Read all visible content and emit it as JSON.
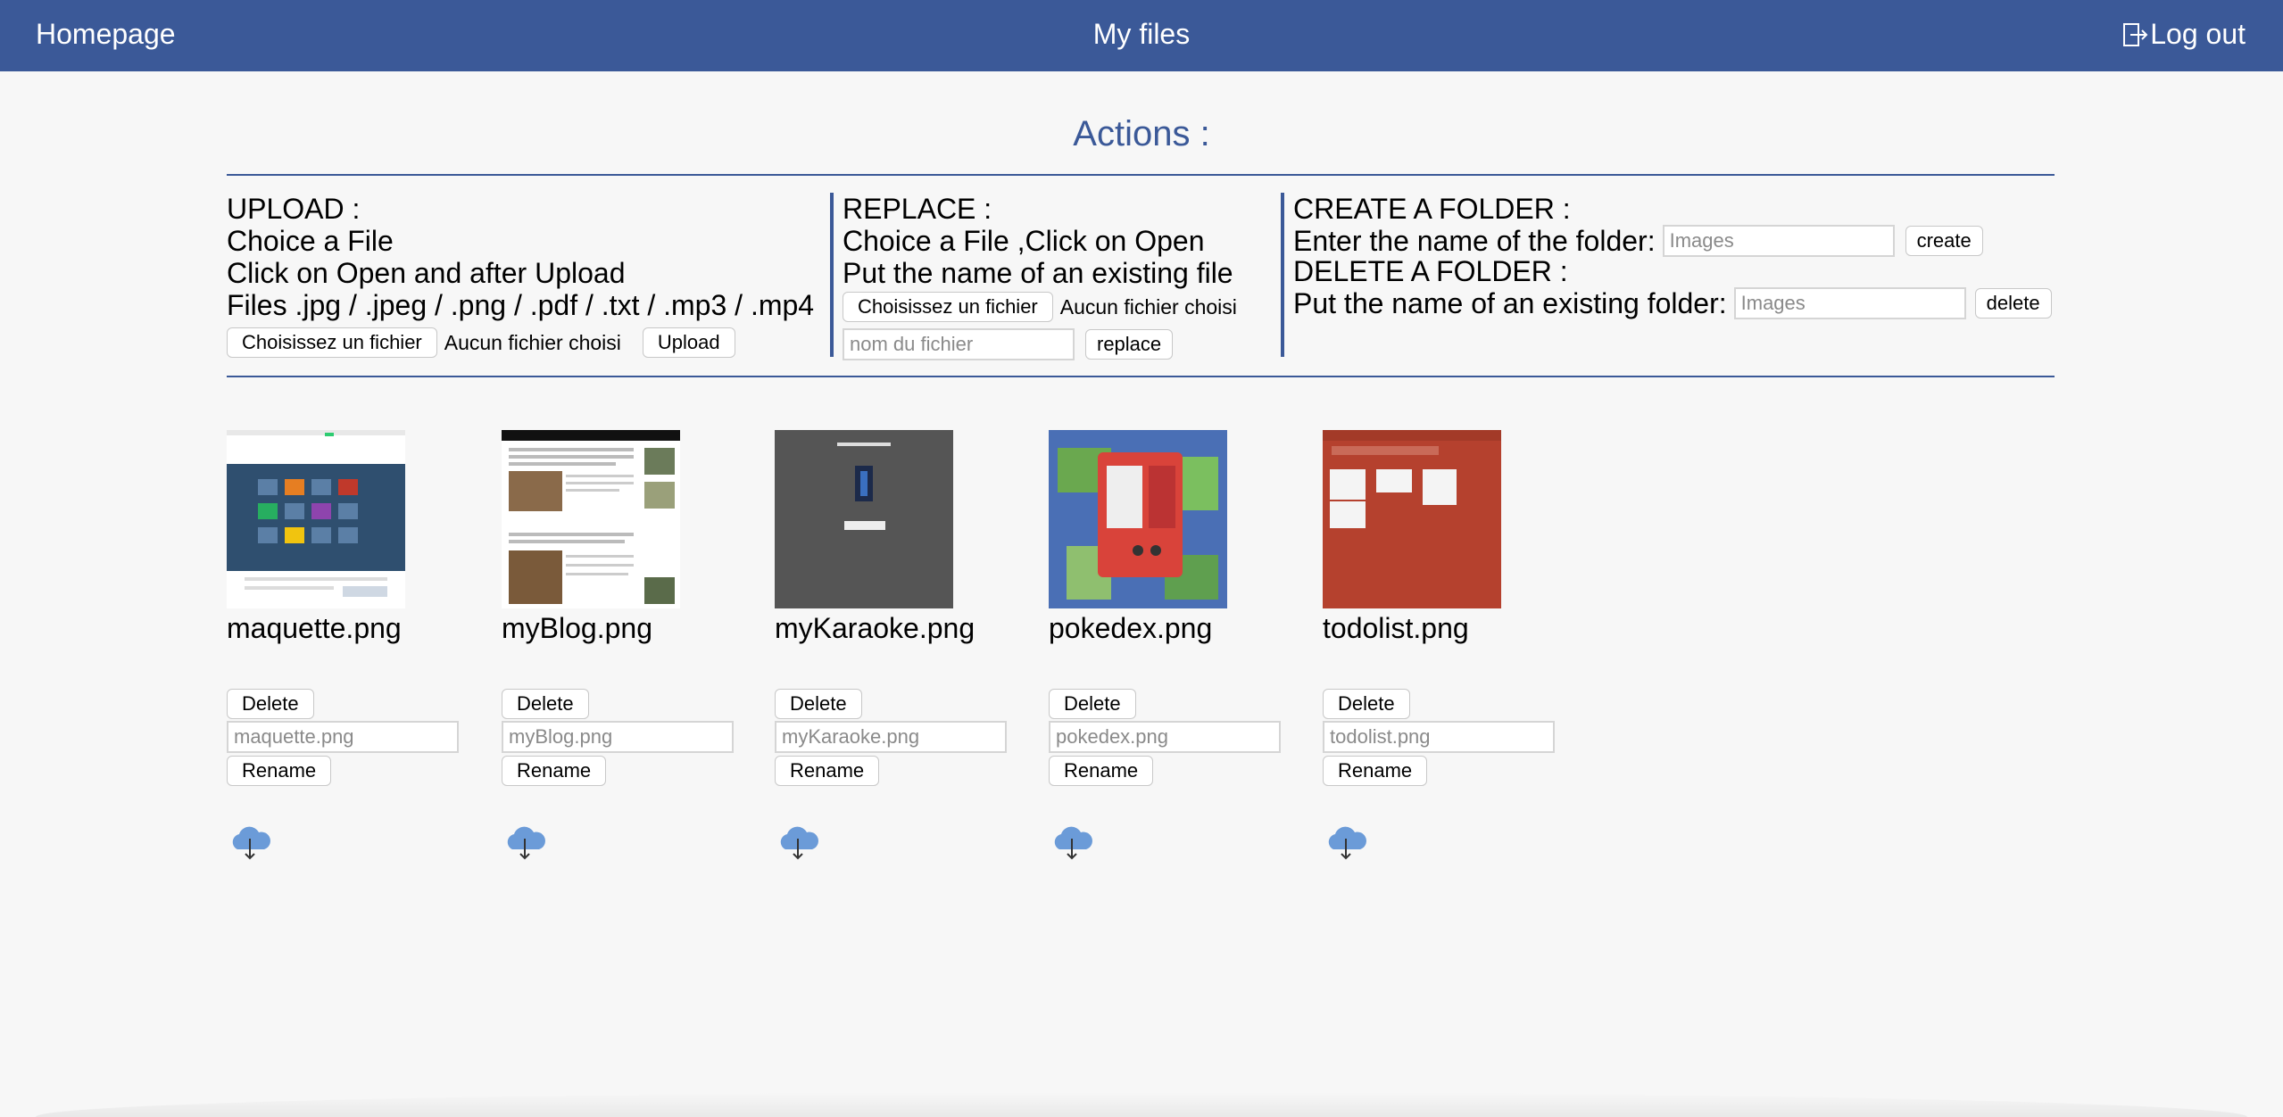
{
  "nav": {
    "home": "Homepage",
    "title": "My files",
    "logout": "Log out"
  },
  "actions_title": "Actions :",
  "upload": {
    "heading": "UPLOAD :",
    "line1": "Choice a File",
    "line2": "Click on Open and after Upload",
    "line3": "Files .jpg / .jpeg / .png / .pdf / .txt / .mp3 / .mp4",
    "choose_button": "Choisissez un fichier",
    "no_file": "Aucun fichier choisi",
    "upload_button": "Upload"
  },
  "replace": {
    "heading": "REPLACE :",
    "line1": "Choice a File ,Click on Open",
    "line2": "Put the name of an existing file",
    "choose_button": "Choisissez un fichier",
    "no_file": "Aucun fichier choisi",
    "input_placeholder": "nom du fichier",
    "replace_button": "replace"
  },
  "folder": {
    "create_heading": "CREATE A FOLDER :",
    "create_label": "Enter the name of the folder:",
    "create_placeholder": "Images",
    "create_button": "create",
    "delete_heading": "DELETE A FOLDER :",
    "delete_label": "Put the name of an existing folder:",
    "delete_placeholder": "Images",
    "delete_button": "delete"
  },
  "files": [
    {
      "name": "maquette.png",
      "delete_label": "Delete",
      "rename_placeholder": "maquette.png",
      "rename_label": "Rename",
      "thumb_color": "#2f4f6f"
    },
    {
      "name": "myBlog.png",
      "delete_label": "Delete",
      "rename_placeholder": "myBlog.png",
      "rename_label": "Rename",
      "thumb_color": "#ffffff"
    },
    {
      "name": "myKaraoke.png",
      "delete_label": "Delete",
      "rename_placeholder": "myKaraoke.png",
      "rename_label": "Rename",
      "thumb_color": "#555555"
    },
    {
      "name": "pokedex.png",
      "delete_label": "Delete",
      "rename_placeholder": "pokedex.png",
      "rename_label": "Rename",
      "thumb_color": "#4a6fb5"
    },
    {
      "name": "todolist.png",
      "delete_label": "Delete",
      "rename_placeholder": "todolist.png",
      "rename_label": "Rename",
      "thumb_color": "#b5412e"
    }
  ],
  "colors": {
    "header": "#3b5998",
    "accent": "#3b5998",
    "cloud": "#5b8fd1"
  },
  "icons": {
    "logout": "logout-icon",
    "download": "cloud-download-icon"
  }
}
